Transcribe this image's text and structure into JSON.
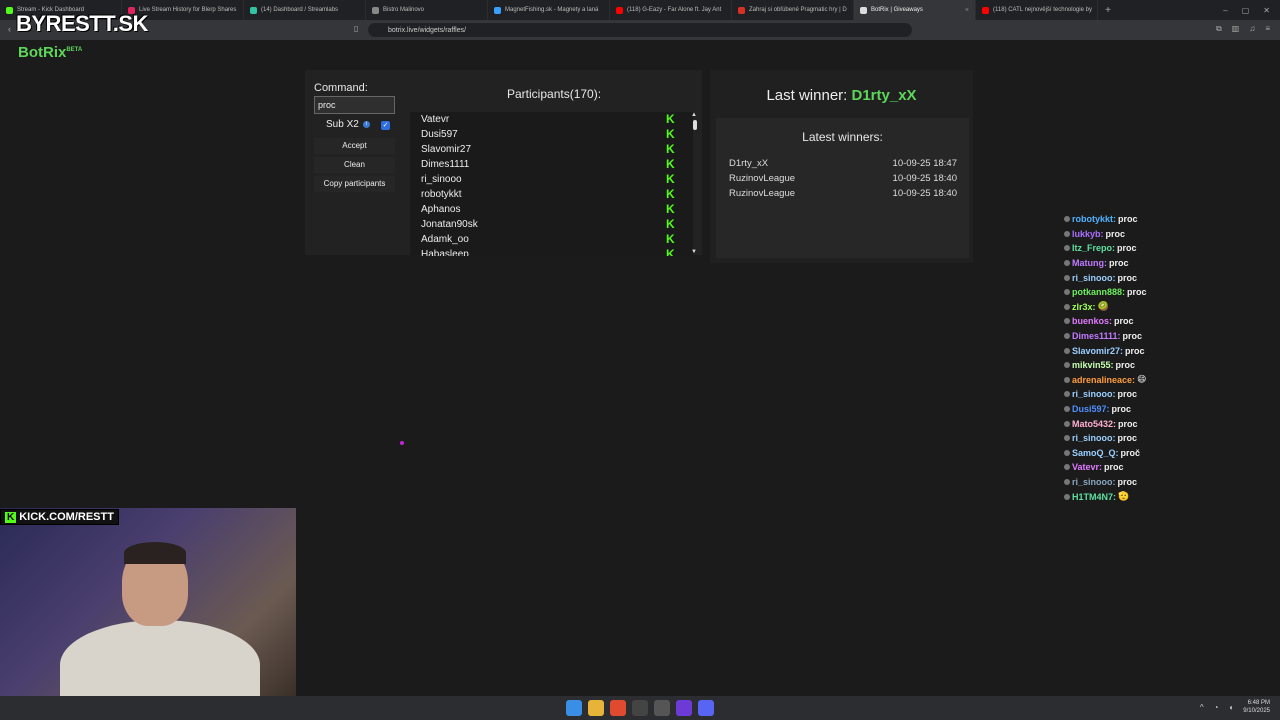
{
  "overlay": {
    "brand_text": "BYRESTT.SK",
    "kick_banner_k": "K",
    "kick_banner_text": "KICK.COM/RESTT"
  },
  "browser": {
    "tabs": [
      {
        "title": "Stream - Kick Dashboard",
        "color": "#53fc18"
      },
      {
        "title": "Live Stream History for Blerp Shares",
        "color": "#e0245e"
      },
      {
        "title": "(14) Dashboard / Streamlabs",
        "color": "#31c3a2"
      },
      {
        "title": "Bistro Malinovo",
        "color": "#888888"
      },
      {
        "title": "MagnetFishing.sk - Magnety a laná",
        "color": "#3aa0ff"
      },
      {
        "title": "(118) G-Eazy - Far Alone ft. Jay Ant",
        "color": "#ff0000"
      },
      {
        "title": "Zahraj si obľúbené Pragmatic hry | D",
        "color": "#d93025"
      },
      {
        "title": "BotRix | Giveaways",
        "color": "#dddddd"
      },
      {
        "title": "(118) CATL nejnovější technologie by",
        "color": "#ff0000"
      }
    ],
    "new_tab": "+",
    "tab_close": "×",
    "url": "botrix.live/widgets/raffles/"
  },
  "app": {
    "logo": "BotRix",
    "logo_badge": "BETA",
    "command_label": "Command:",
    "command_value": "proc",
    "sub_label": "Sub X2",
    "sub_checked": "✓",
    "accept_label": "Accept",
    "clean_label": "Clean",
    "copy_label": "Copy participants",
    "participants_title": "Participants(170):",
    "participants": [
      "Vatevr",
      "Dusi597",
      "Slavomir27",
      "Dimes1111",
      "ri_sinooo",
      "robotykkt",
      "Aphanos",
      "Jonatan90sk",
      "Adamk_oo",
      "Habasleep"
    ],
    "kick_glyph": "K",
    "scroll_up": "▲",
    "scroll_down": "▼",
    "last_winner_label": "Last winner: ",
    "last_winner_name": "D1rty_xX",
    "latest_winners_title": "Latest winners:",
    "latest_winners": [
      {
        "name": "D1rty_xX",
        "time": "10-09-25 18:47"
      },
      {
        "name": "RuzinovLeague",
        "time": "10-09-25 18:40"
      },
      {
        "name": "RuzinovLeague",
        "time": "10-09-25 18:40"
      }
    ]
  },
  "chat": [
    {
      "user": "robotykkt:",
      "msg": "proc",
      "color": "#4fb3ff"
    },
    {
      "user": "lukkyb:",
      "msg": "proc",
      "color": "#a970ff"
    },
    {
      "user": "Itz_Frepo:",
      "msg": "proc",
      "color": "#5ee0a0"
    },
    {
      "user": "Matung:",
      "msg": "proc",
      "color": "#c07aff"
    },
    {
      "user": "ri_sinooo:",
      "msg": "proc",
      "color": "#9ad0ff"
    },
    {
      "user": "potkann888:",
      "msg": "proc",
      "color": "#6ef060"
    },
    {
      "user": "zlr3x:",
      "msg": "🥝",
      "color": "#9cff5a"
    },
    {
      "user": "buenkos:",
      "msg": "proc",
      "color": "#e27aff"
    },
    {
      "user": "Dimes1111:",
      "msg": "proc",
      "color": "#c07aff"
    },
    {
      "user": "Slavomir27:",
      "msg": "proc",
      "color": "#9ad0ff"
    },
    {
      "user": "mikvin55:",
      "msg": "proc",
      "color": "#c8ffb0"
    },
    {
      "user": "adrenalineace:",
      "msg": "😄",
      "color": "#ff9d3a"
    },
    {
      "user": "ri_sinooo:",
      "msg": "proc",
      "color": "#9ad0ff"
    },
    {
      "user": "Dusi597:",
      "msg": "proc",
      "color": "#4f8fff"
    },
    {
      "user": "Mato5432:",
      "msg": "proc",
      "color": "#ffb0d0"
    },
    {
      "user": "ri_sinooo:",
      "msg": "proc",
      "color": "#9ad0ff"
    },
    {
      "user": "SamoQ_Q:",
      "msg": "proč",
      "color": "#9ad0ff"
    },
    {
      "user": "Vatevr:",
      "msg": "proc",
      "color": "#e27aff"
    },
    {
      "user": "ri_sinooo:",
      "msg": "proc",
      "color": "#8aa6c0"
    },
    {
      "user": "H1TM4N7:",
      "msg": "🫡",
      "color": "#5ee0a0"
    }
  ],
  "taskbar": {
    "time": "6:48 PM",
    "date": "9/10/2025",
    "tray_up": "^"
  }
}
